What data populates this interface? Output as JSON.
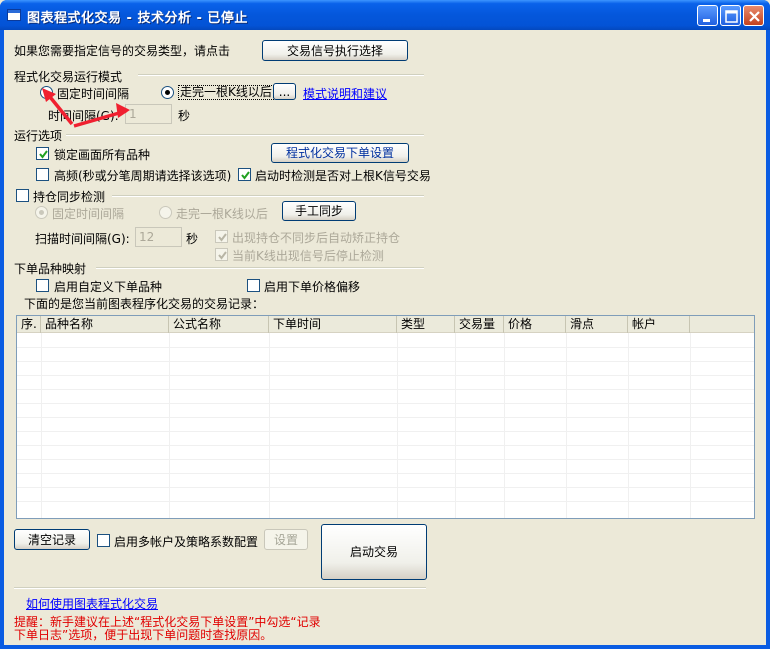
{
  "window": {
    "title": "图表程式化交易 - 技术分析 - 已停止"
  },
  "signal_select": {
    "prompt": "如果您需要指定信号的交易类型，请点击",
    "button": "交易信号执行选择"
  },
  "run_mode": {
    "section_title": "程式化交易运行模式",
    "fixed_interval_label": "固定时间间隔",
    "after_kline_label": "走完一根K线以后",
    "more_button": "...",
    "help_link": "模式说明和建议",
    "interval_label": "时间间隔(G):",
    "interval_value": "1",
    "interval_unit": "秒",
    "selected": "after_kline"
  },
  "run_options": {
    "section_title": "运行选项",
    "lock_all_label": "锁定画面所有品种",
    "lock_all_checked": true,
    "order_settings_button": "程式化交易下单设置",
    "high_freq_label": "高频(秒或分笔周期请选择该选项)",
    "high_freq_checked": false,
    "check_last_signal_label": "启动时检测是否对上根K信号交易",
    "check_last_signal_checked": true
  },
  "position_sync": {
    "section_title": "持仓同步检测",
    "enabled": false,
    "fixed_interval_label": "固定时间间隔",
    "after_kline_label": "走完一根K线以后",
    "manual_sync_button": "手工同步",
    "scan_interval_label": "扫描时间间隔(G):",
    "scan_interval_value": "12",
    "scan_interval_unit": "秒",
    "auto_fix_label": "出现持仓不同步后自动矫正持仓",
    "auto_fix_checked": true,
    "stop_detect_label": "当前K线出现信号后停止检测",
    "stop_detect_checked": true
  },
  "order_mapping": {
    "section_title": "下单品种映射",
    "custom_symbol_label": "启用自定义下单品种",
    "custom_symbol_checked": false,
    "price_offset_label": "启用下单价格偏移",
    "price_offset_checked": false
  },
  "records": {
    "caption": "下面的是您当前图表程序化交易的交易记录：",
    "columns": [
      "序.",
      "品种名称",
      "公式名称",
      "下单时间",
      "类型",
      "交易量",
      "价格",
      "滑点",
      "帐户"
    ],
    "rows": []
  },
  "bottom": {
    "clear_button": "清空记录",
    "multi_account_label": "启用多帐户及策略系数配置",
    "multi_account_checked": false,
    "settings_button": "设置",
    "start_button": "启动交易",
    "howto_link": "如何使用图表程式化交易",
    "tip_line1": "提醒：新手建议在上述“程式化交易下单设置”中勾选“记录",
    "tip_line2": "下单日志”选项，便于出现下单问题时查找原因。"
  },
  "colors": {
    "titlebar": "#0353D6",
    "face": "#ECE9D8",
    "link": "#0000FF",
    "tip": "#E00000",
    "arrow": "#F02030"
  }
}
